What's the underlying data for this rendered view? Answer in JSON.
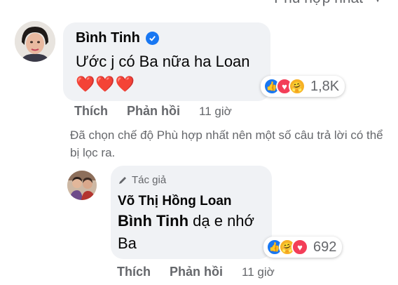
{
  "sort": {
    "label": "Phù hợp nhất",
    "icon": "chevron-down-icon"
  },
  "comment1": {
    "author": "Bình Tinh",
    "verified": true,
    "text": "Ước j có Ba nữa ha Loan",
    "hearts": "❤️❤️❤️",
    "reactions": {
      "icons": [
        "like-icon",
        "love-icon",
        "care-icon"
      ],
      "count": "1,8K"
    },
    "actions": {
      "like": "Thích",
      "reply": "Phản hồi",
      "time": "11 giờ"
    }
  },
  "filter_note": "Đã chọn chế độ Phù hợp nhất nên một số câu trả lời có thể bị lọc ra.",
  "reply1": {
    "badge": "Tác giả",
    "author": "Võ Thị Hồng Loan",
    "mention": "Bình Tinh",
    "text": " dạ e nhớ Ba",
    "reactions": {
      "icons": [
        "like-icon",
        "care-icon",
        "love-icon"
      ],
      "count": "692"
    },
    "actions": {
      "like": "Thích",
      "reply": "Phản hồi",
      "time": "11 giờ"
    }
  },
  "colors": {
    "bubble": "#f0f2f5",
    "secondary_text": "#65676b",
    "like_blue": "#1877f2",
    "love_red": "#f33e58",
    "care_yellow": "#f7b125"
  }
}
